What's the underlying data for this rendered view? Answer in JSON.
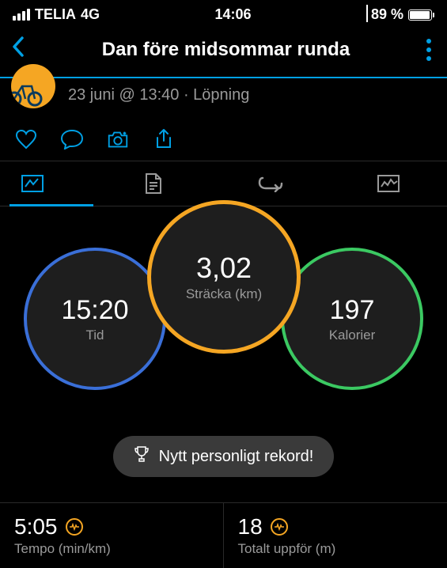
{
  "status": {
    "carrier": "TELIA",
    "network": "4G",
    "time": "14:06",
    "battery_pct": "89 %"
  },
  "header": {
    "title": "Dan före midsommar runda"
  },
  "meta": {
    "subtitle": "23 juni @ 13:40 · Löpning"
  },
  "circles": {
    "time": {
      "value": "15:20",
      "label": "Tid"
    },
    "distance": {
      "value": "3,02",
      "label": "Sträcka (km)"
    },
    "calories": {
      "value": "197",
      "label": "Kalorier"
    }
  },
  "pr": {
    "text": "Nytt personligt rekord!"
  },
  "stats": {
    "pace": {
      "value": "5:05",
      "label": "Tempo (min/km)"
    },
    "elev": {
      "value": "18",
      "label": "Totalt uppför (m)"
    }
  }
}
